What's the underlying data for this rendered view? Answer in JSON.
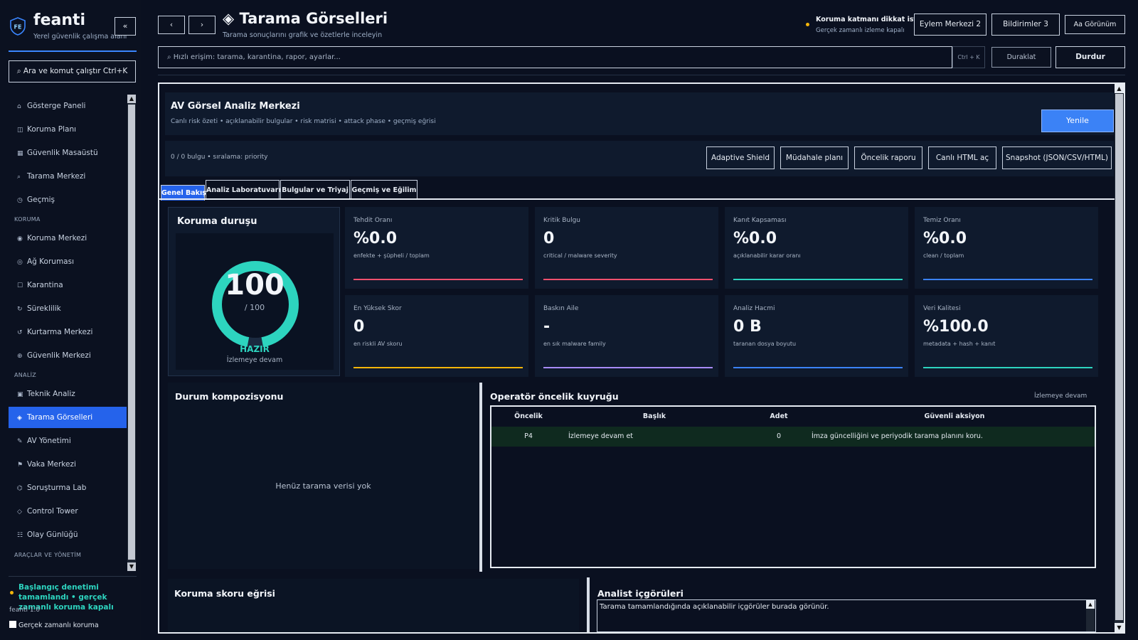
{
  "app": {
    "name": "feanti",
    "subtitle": "Yerel güvenlik çalışma alanı",
    "collapse_label": "«",
    "command_search_label": "⌕ Ara ve komut çalıştır   Ctrl+K"
  },
  "sidebar": {
    "sections": {
      "koruma": "KORUMA",
      "analiz": "ANALİZ",
      "araclar": "ARAÇLAR VE YÖNETİM"
    },
    "items": [
      {
        "label": "Gösterge Paneli",
        "icon": "⌂"
      },
      {
        "label": "Koruma Planı",
        "icon": "◫"
      },
      {
        "label": "Güvenlik Masaüstü",
        "icon": "▦"
      },
      {
        "label": "Tarama Merkezi",
        "icon": "⌕"
      },
      {
        "label": "Geçmiş",
        "icon": "◷"
      },
      {
        "label": "Koruma Merkezi",
        "icon": "◉"
      },
      {
        "label": "Ağ Koruması",
        "icon": "◎"
      },
      {
        "label": "Karantina",
        "icon": "☐"
      },
      {
        "label": "Süreklilik",
        "icon": "↻"
      },
      {
        "label": "Kurtarma Merkezi",
        "icon": "↺"
      },
      {
        "label": "Güvenlik Merkezi",
        "icon": "⊕"
      },
      {
        "label": "Teknik Analiz",
        "icon": "▣"
      },
      {
        "label": "Tarama Görselleri",
        "icon": "◈"
      },
      {
        "label": "AV Yönetimi",
        "icon": "✎"
      },
      {
        "label": "Vaka Merkezi",
        "icon": "⚑"
      },
      {
        "label": "Soruşturma Lab",
        "icon": "⌬"
      },
      {
        "label": "Control Tower",
        "icon": "◇"
      },
      {
        "label": "Olay Günlüğü",
        "icon": "☷"
      }
    ],
    "active_item": "Tarama Görselleri",
    "status_text": "Başlangıç denetimi tamamlandı • gerçek zamanlı koruma kapalı",
    "version": "feanti 1.0",
    "realtime_checkbox_label": "Gerçek zamanlı koruma",
    "realtime_checked": false
  },
  "header": {
    "back_label": "‹",
    "forward_label": "›",
    "title": "◈ Tarama Görselleri",
    "subtitle": "Tarama sonuçlarını grafik ve özetlerle inceleyin",
    "alert_title": "Koruma katmanı dikkat istiyor",
    "alert_sub": "Gerçek zamanlı izleme kapalı",
    "action_center": "Eylem Merkezi  2",
    "notifications": "Bildirimler 3",
    "view": "Aa Görünüm",
    "search_placeholder": "⌕ Hızlı erişim: tarama, karantina, rapor, ayarlar...",
    "search_shortcut": "Ctrl + K",
    "pause_label": "Duraklat",
    "stop_label": "Durdur"
  },
  "hero": {
    "title": "AV Görsel Analiz Merkezi",
    "subtitle": "Canlı risk özeti • açıklanabilir bulgular • risk matrisi • attack phase • geçmiş eğrisi",
    "refresh_label": "Yenile"
  },
  "toolbar": {
    "count_text": "0 / 0 bulgu • sıralama: priority",
    "buttons": [
      "Adaptive Shield",
      "Müdahale planı",
      "Öncelik raporu",
      "Canlı HTML aç",
      "Snapshot (JSON/CSV/HTML)"
    ]
  },
  "tabs": [
    "Genel Bakış",
    "Analiz Laboratuvarı",
    "Bulgular ve Triyaj",
    "Geçmiş ve Eğilim"
  ],
  "active_tab": "Genel Bakış",
  "score": {
    "title": "Koruma duruşu",
    "value": "100",
    "max_text": "/ 100",
    "fraction": 1.0,
    "state": "HAZIR",
    "state_sub": "İzlemeye devam",
    "color": "#2dd4bf"
  },
  "metrics": [
    {
      "label": "Tehdit Oranı",
      "value": "%0.0",
      "sub": "enfekte + şüpheli / toplam",
      "color": "#f0506e"
    },
    {
      "label": "Kritik Bulgu",
      "value": "0",
      "sub": "critical / malware severity",
      "color": "#f0506e"
    },
    {
      "label": "Kanıt Kapsaması",
      "value": "%0.0",
      "sub": "açıklanabilir karar oranı",
      "color": "#2dd4bf"
    },
    {
      "label": "Temiz Oranı",
      "value": "%0.0",
      "sub": "clean / toplam",
      "color": "#3b82f6"
    },
    {
      "label": "En Yüksek Skor",
      "value": "0",
      "sub": "en riskli AV skoru",
      "color": "#f5b50a"
    },
    {
      "label": "Baskın Aile",
      "value": "-",
      "sub": "en sık malware family",
      "color": "#a78bfa"
    },
    {
      "label": "Analiz Hacmi",
      "value": "0 B",
      "sub": "taranan dosya boyutu",
      "color": "#3b82f6"
    },
    {
      "label": "Veri Kalitesi",
      "value": "%100.0",
      "sub": "metadata + hash + kanıt",
      "color": "#2dd4bf"
    }
  ],
  "composition": {
    "title": "Durum kompozisyonu",
    "empty_text": "Henüz tarama verisi yok"
  },
  "queue": {
    "title": "Operatör öncelik kuyruğu",
    "status": "İzlemeye devam",
    "columns": [
      "Öncelik",
      "Başlık",
      "Adet",
      "Güvenli aksiyon"
    ],
    "rows": [
      {
        "priority": "P4",
        "title": "İzlemeye devam et",
        "count": "0",
        "action": "İmza güncelliğini ve periyodik tarama planını koru."
      }
    ]
  },
  "curve": {
    "title": "Koruma skoru eğrisi"
  },
  "insights": {
    "title": "Analist içgörüleri",
    "text": "Tarama tamamlandığında açıklanabilir içgörüler burada görünür."
  }
}
